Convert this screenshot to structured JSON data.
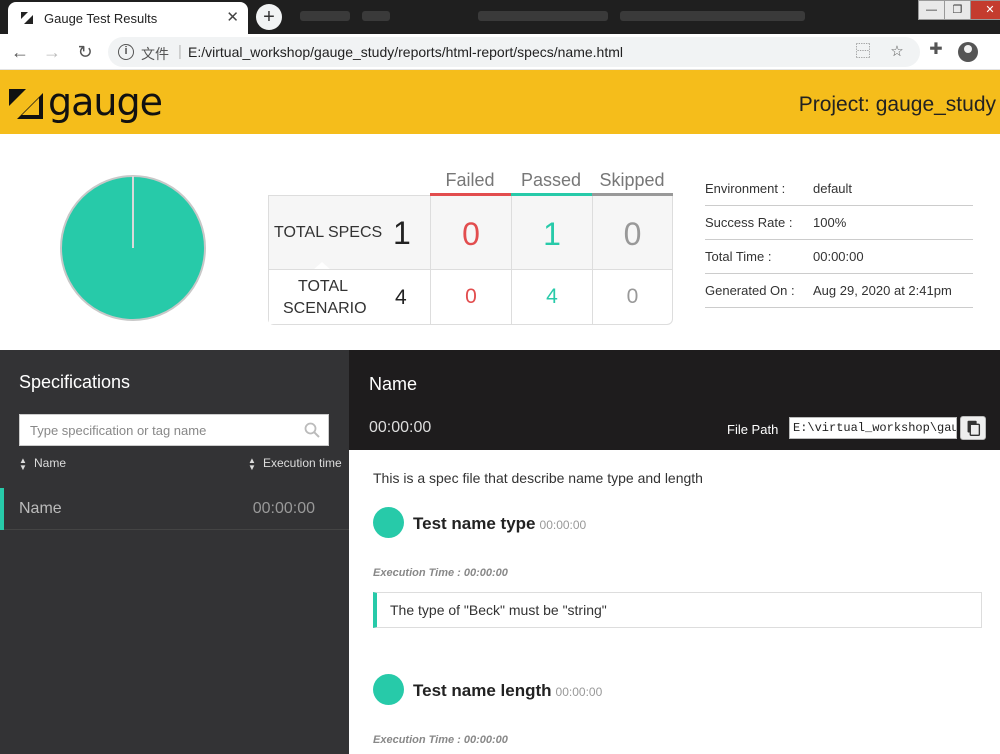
{
  "browser": {
    "tab_title": "Gauge Test Results",
    "address_label": "文件",
    "url": "E:/virtual_workshop/gauge_study/reports/html-report/specs/name.html"
  },
  "header": {
    "logo_text": "gauge",
    "project": "Project: gauge_study"
  },
  "summary": {
    "columns": [
      "Failed",
      "Passed",
      "Skipped"
    ],
    "rows": [
      {
        "label": "TOTAL SPECS",
        "total": "1",
        "failed": "0",
        "passed": "1",
        "skipped": "0"
      },
      {
        "label": "TOTAL SCENARIO",
        "total": "4",
        "failed": "0",
        "passed": "4",
        "skipped": "0"
      }
    ],
    "pie_passed_fraction": 1.0,
    "colors": {
      "failed": "#e24d4e",
      "passed": "#27caa9",
      "skipped": "#999999",
      "accent": "#f5bd1b"
    }
  },
  "environment": [
    {
      "key": "Environment :",
      "value": "default"
    },
    {
      "key": "Success Rate :",
      "value": "100%"
    },
    {
      "key": "Total Time :",
      "value": "00:00:00"
    },
    {
      "key": "Generated On :",
      "value": "Aug 29, 2020 at 2:41pm"
    }
  ],
  "sidebar": {
    "title": "Specifications",
    "search_placeholder": "Type specification or tag name",
    "sort_name": "Name",
    "sort_time": "Execution time",
    "items": [
      {
        "name": "Name",
        "time": "00:00:00"
      }
    ]
  },
  "spec": {
    "heading": "Name",
    "duration": "00:00:00",
    "file_path_label": "File Path",
    "file_path": "E:\\virtual_workshop\\gauge_study\\specs\\name.spec",
    "description": "This is a spec file that describe name type and length",
    "scenarios": [
      {
        "title": "Test name type",
        "time": "00:00:00",
        "exec_label": "Execution Time : 00:00:00",
        "step": "The type of \"Beck\" must be \"string\""
      },
      {
        "title": "Test name length",
        "time": "00:00:00",
        "exec_label": "Execution Time : 00:00:00"
      }
    ]
  }
}
